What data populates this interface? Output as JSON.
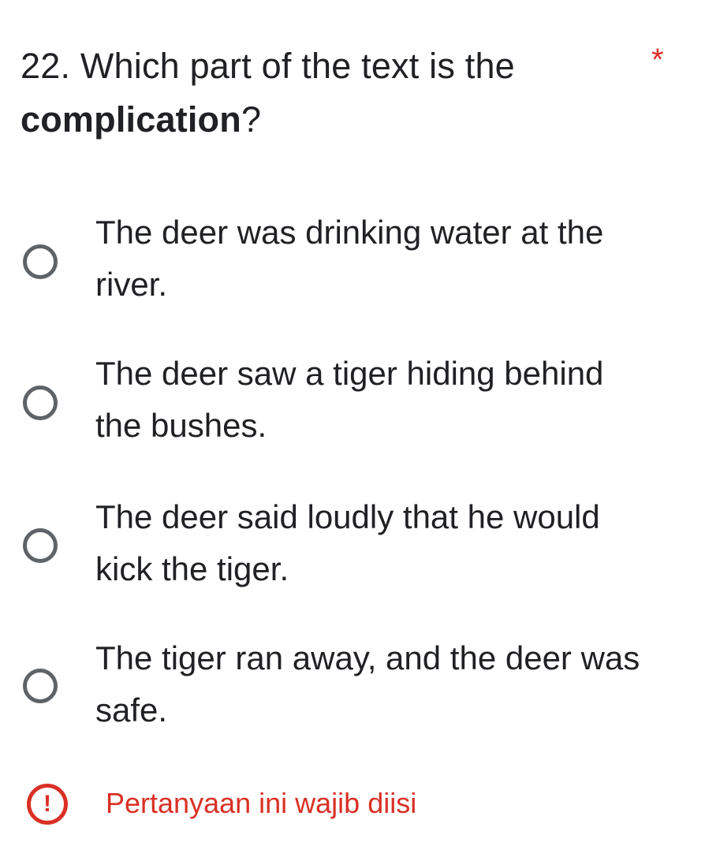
{
  "question": {
    "number_and_text": "22. Which part of the text is the",
    "bold_word": "complication",
    "punctuation": "?",
    "required_marker": "*"
  },
  "options": [
    {
      "label": "The deer was drinking water at the river.",
      "selected": false
    },
    {
      "label": "The deer saw a tiger hiding behind the bushes.",
      "selected": false
    },
    {
      "label": "The deer said loudly that he would kick the tiger.",
      "selected": false
    },
    {
      "label": "The tiger ran away, and the deer was safe.",
      "selected": false
    }
  ],
  "validation": {
    "icon": "error-exclamation-icon",
    "icon_glyph": "!",
    "message": "Pertanyaan ini wajib diisi"
  },
  "colors": {
    "text": "#202124",
    "radio_border": "#5f6368",
    "error": "#d93025"
  }
}
